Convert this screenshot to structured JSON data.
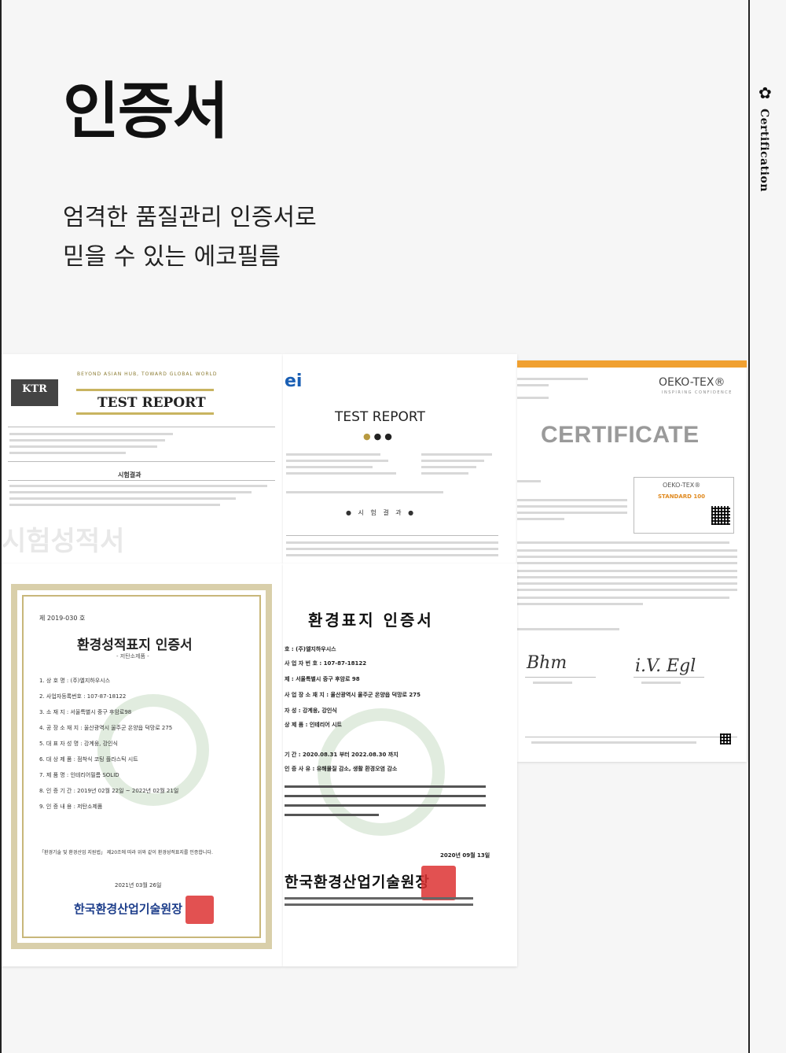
{
  "side_label": {
    "icon": "flower-icon",
    "text": "Certification"
  },
  "title": "인증서",
  "subtitle": {
    "line1": "엄격한 품질관리 인증서로",
    "line2": "믿을 수 있는 에코필름"
  },
  "docs": {
    "ktr": {
      "logo": "KTR",
      "tagline": "BEYOND ASIAN HUB, TOWARD GLOBAL WORLD",
      "title": "TEST REPORT",
      "section": "시험결과",
      "watermark": "시험성적서"
    },
    "test_report": {
      "logo": "ei",
      "title": "TEST REPORT",
      "section": "시 험 결 과"
    },
    "certificate": {
      "brand": "OEKO-TEX®",
      "inspiring": "INSPIRING CONFIDENCE",
      "title": "CERTIFICATE",
      "box_brand": "OEKO-TEX®",
      "box_standard": "STANDARD 100"
    },
    "env_cert": {
      "number": "제 2019-030 호",
      "title": "환경성적표지 인증서",
      "subtitle": "- 저탄소제품 -",
      "rows": [
        "1. 상       호       명 : (주)엘지하우시스",
        "2. 사업자등록번호 : 107-87-18122",
        "3. 소       재       지 : 서울특별시 중구 후암로98",
        "4. 공  장  소  재  지 : 울산광역시 울주군 온양읍 덕망로 275",
        "5. 대  표  자  성  명 : 강계웅, 강인식",
        "6. 대  상  제  품 : 점착식 코팅 플라스틱 시트",
        "7. 제       품       명 : 인테리어필름 SOLID",
        "8. 인  증  기  간 : 2019년 02월 22일 ~ 2022년 02월 21일",
        "9. 인  증  내  용 : 저탄소제품"
      ],
      "footer": "「환경기술 및 환경산업 지원법」 제20조에 따라 위와 같이 환경성적표지를 인증합니다.",
      "date": "2021년 03월 26일",
      "org": "한국환경산업기술원장"
    },
    "env_cert2": {
      "title": "환경표지 인증서",
      "rows": [
        "호 : (주)엘지하우시스",
        "사 업 자 번 호 : 107-87-18122",
        "제 : 서울특별시 중구 후암로 98",
        "사 업 장 소 재 지 : 울산광역시 울주군 온양읍 덕망로 275",
        "자 성 : 강계웅, 강인식",
        "상 제 품 : 인테리어 시트",
        "기 간 : 2020.08.31 부터 2022.08.30 까지",
        "인 증 사 유 : 유해물질 감소, 생활 환경오염 감소"
      ],
      "date": "2020년 09월 13일",
      "org": "한국환경산업기술원장"
    }
  },
  "colors": {
    "accent_orange": "#f0a030",
    "seal_red": "#d33",
    "org_blue": "#1c3d8a"
  }
}
